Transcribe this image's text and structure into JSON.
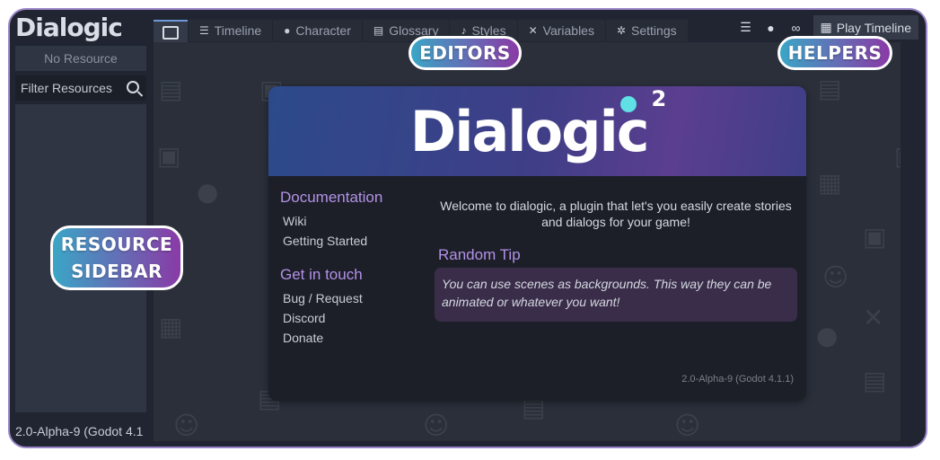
{
  "app": {
    "logo": "Dialogic",
    "version": "2.0-Alpha-9 (Godot 4.1"
  },
  "sidebar": {
    "no_resource": "No Resource",
    "filter_placeholder": "Filter Resources"
  },
  "tabs": [
    {
      "label": ""
    },
    {
      "label": "Timeline"
    },
    {
      "label": "Character"
    },
    {
      "label": "Glossary"
    },
    {
      "label": "Styles"
    },
    {
      "label": "Variables"
    },
    {
      "label": "Settings"
    }
  ],
  "helpers": {
    "play_label": "Play Timeline"
  },
  "welcome": {
    "logo": "Dialogic",
    "logo_sup": "2",
    "documentation_title": "Documentation",
    "doc_links": [
      "Wiki",
      "Getting Started"
    ],
    "contact_title": "Get in touch",
    "contact_links": [
      "Bug / Request",
      "Discord",
      "Donate"
    ],
    "intro": "Welcome to dialogic, a plugin that let's you easily create stories and dialogs for your game!",
    "tip_title": "Random Tip",
    "tip_text": "You can use scenes as backgrounds. This way they can be animated or whatever you want!",
    "version": "2.0-Alpha-9 (Godot 4.1.1)"
  },
  "annotations": {
    "editors": "EDITORS",
    "helpers": "HELPERS",
    "resource_line1": "RESOURCE",
    "resource_line2": "SIDEBAR"
  },
  "colors": {
    "accent_purple": "#b391e8",
    "tab_active_border": "#6f98d8",
    "label_gradient_start": "#3aa6c6",
    "label_gradient_end": "#8a3aa6"
  }
}
